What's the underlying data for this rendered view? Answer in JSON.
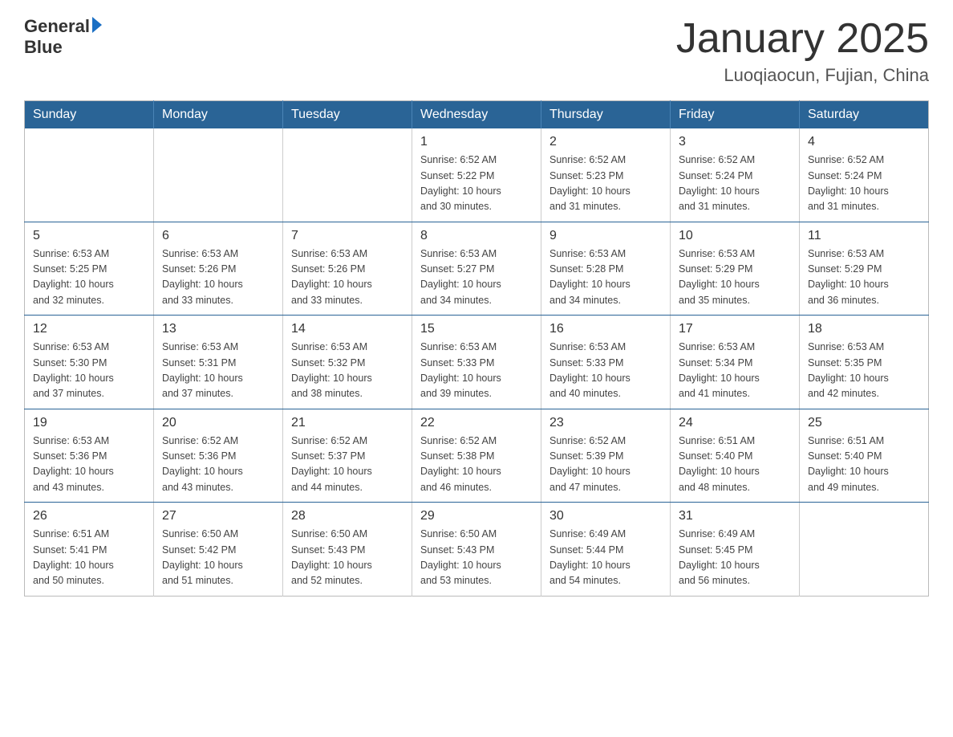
{
  "header": {
    "logo_general": "General",
    "logo_blue": "Blue",
    "month_title": "January 2025",
    "location": "Luoqiaocun, Fujian, China"
  },
  "weekdays": [
    "Sunday",
    "Monday",
    "Tuesday",
    "Wednesday",
    "Thursday",
    "Friday",
    "Saturday"
  ],
  "weeks": [
    [
      {
        "day": "",
        "info": ""
      },
      {
        "day": "",
        "info": ""
      },
      {
        "day": "",
        "info": ""
      },
      {
        "day": "1",
        "info": "Sunrise: 6:52 AM\nSunset: 5:22 PM\nDaylight: 10 hours\nand 30 minutes."
      },
      {
        "day": "2",
        "info": "Sunrise: 6:52 AM\nSunset: 5:23 PM\nDaylight: 10 hours\nand 31 minutes."
      },
      {
        "day": "3",
        "info": "Sunrise: 6:52 AM\nSunset: 5:24 PM\nDaylight: 10 hours\nand 31 minutes."
      },
      {
        "day": "4",
        "info": "Sunrise: 6:52 AM\nSunset: 5:24 PM\nDaylight: 10 hours\nand 31 minutes."
      }
    ],
    [
      {
        "day": "5",
        "info": "Sunrise: 6:53 AM\nSunset: 5:25 PM\nDaylight: 10 hours\nand 32 minutes."
      },
      {
        "day": "6",
        "info": "Sunrise: 6:53 AM\nSunset: 5:26 PM\nDaylight: 10 hours\nand 33 minutes."
      },
      {
        "day": "7",
        "info": "Sunrise: 6:53 AM\nSunset: 5:26 PM\nDaylight: 10 hours\nand 33 minutes."
      },
      {
        "day": "8",
        "info": "Sunrise: 6:53 AM\nSunset: 5:27 PM\nDaylight: 10 hours\nand 34 minutes."
      },
      {
        "day": "9",
        "info": "Sunrise: 6:53 AM\nSunset: 5:28 PM\nDaylight: 10 hours\nand 34 minutes."
      },
      {
        "day": "10",
        "info": "Sunrise: 6:53 AM\nSunset: 5:29 PM\nDaylight: 10 hours\nand 35 minutes."
      },
      {
        "day": "11",
        "info": "Sunrise: 6:53 AM\nSunset: 5:29 PM\nDaylight: 10 hours\nand 36 minutes."
      }
    ],
    [
      {
        "day": "12",
        "info": "Sunrise: 6:53 AM\nSunset: 5:30 PM\nDaylight: 10 hours\nand 37 minutes."
      },
      {
        "day": "13",
        "info": "Sunrise: 6:53 AM\nSunset: 5:31 PM\nDaylight: 10 hours\nand 37 minutes."
      },
      {
        "day": "14",
        "info": "Sunrise: 6:53 AM\nSunset: 5:32 PM\nDaylight: 10 hours\nand 38 minutes."
      },
      {
        "day": "15",
        "info": "Sunrise: 6:53 AM\nSunset: 5:33 PM\nDaylight: 10 hours\nand 39 minutes."
      },
      {
        "day": "16",
        "info": "Sunrise: 6:53 AM\nSunset: 5:33 PM\nDaylight: 10 hours\nand 40 minutes."
      },
      {
        "day": "17",
        "info": "Sunrise: 6:53 AM\nSunset: 5:34 PM\nDaylight: 10 hours\nand 41 minutes."
      },
      {
        "day": "18",
        "info": "Sunrise: 6:53 AM\nSunset: 5:35 PM\nDaylight: 10 hours\nand 42 minutes."
      }
    ],
    [
      {
        "day": "19",
        "info": "Sunrise: 6:53 AM\nSunset: 5:36 PM\nDaylight: 10 hours\nand 43 minutes."
      },
      {
        "day": "20",
        "info": "Sunrise: 6:52 AM\nSunset: 5:36 PM\nDaylight: 10 hours\nand 43 minutes."
      },
      {
        "day": "21",
        "info": "Sunrise: 6:52 AM\nSunset: 5:37 PM\nDaylight: 10 hours\nand 44 minutes."
      },
      {
        "day": "22",
        "info": "Sunrise: 6:52 AM\nSunset: 5:38 PM\nDaylight: 10 hours\nand 46 minutes."
      },
      {
        "day": "23",
        "info": "Sunrise: 6:52 AM\nSunset: 5:39 PM\nDaylight: 10 hours\nand 47 minutes."
      },
      {
        "day": "24",
        "info": "Sunrise: 6:51 AM\nSunset: 5:40 PM\nDaylight: 10 hours\nand 48 minutes."
      },
      {
        "day": "25",
        "info": "Sunrise: 6:51 AM\nSunset: 5:40 PM\nDaylight: 10 hours\nand 49 minutes."
      }
    ],
    [
      {
        "day": "26",
        "info": "Sunrise: 6:51 AM\nSunset: 5:41 PM\nDaylight: 10 hours\nand 50 minutes."
      },
      {
        "day": "27",
        "info": "Sunrise: 6:50 AM\nSunset: 5:42 PM\nDaylight: 10 hours\nand 51 minutes."
      },
      {
        "day": "28",
        "info": "Sunrise: 6:50 AM\nSunset: 5:43 PM\nDaylight: 10 hours\nand 52 minutes."
      },
      {
        "day": "29",
        "info": "Sunrise: 6:50 AM\nSunset: 5:43 PM\nDaylight: 10 hours\nand 53 minutes."
      },
      {
        "day": "30",
        "info": "Sunrise: 6:49 AM\nSunset: 5:44 PM\nDaylight: 10 hours\nand 54 minutes."
      },
      {
        "day": "31",
        "info": "Sunrise: 6:49 AM\nSunset: 5:45 PM\nDaylight: 10 hours\nand 56 minutes."
      },
      {
        "day": "",
        "info": ""
      }
    ]
  ]
}
